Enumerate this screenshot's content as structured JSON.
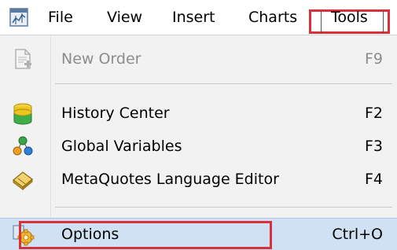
{
  "menubar": {
    "items": [
      {
        "label": "File"
      },
      {
        "label": "View"
      },
      {
        "label": "Insert"
      },
      {
        "label": "Charts"
      },
      {
        "label": "Tools"
      }
    ]
  },
  "dropdown": {
    "items": [
      {
        "label": "New Order",
        "shortcut": "F9",
        "icon": "new-order-icon",
        "disabled": true
      },
      {
        "label": "History Center",
        "shortcut": "F2",
        "icon": "history-center-icon",
        "disabled": false
      },
      {
        "label": "Global Variables",
        "shortcut": "F3",
        "icon": "global-variables-icon",
        "disabled": false
      },
      {
        "label": "MetaQuotes Language Editor",
        "shortcut": "F4",
        "icon": "metaquotes-editor-icon",
        "disabled": false
      },
      {
        "label": "Options",
        "shortcut": "Ctrl+O",
        "icon": "options-gear-icon",
        "disabled": false,
        "highlighted": true
      }
    ]
  },
  "colors": {
    "highlight_box": "#d9303a",
    "selection_bg": "#cfe1f3",
    "disabled_text": "#8c8c8c"
  }
}
